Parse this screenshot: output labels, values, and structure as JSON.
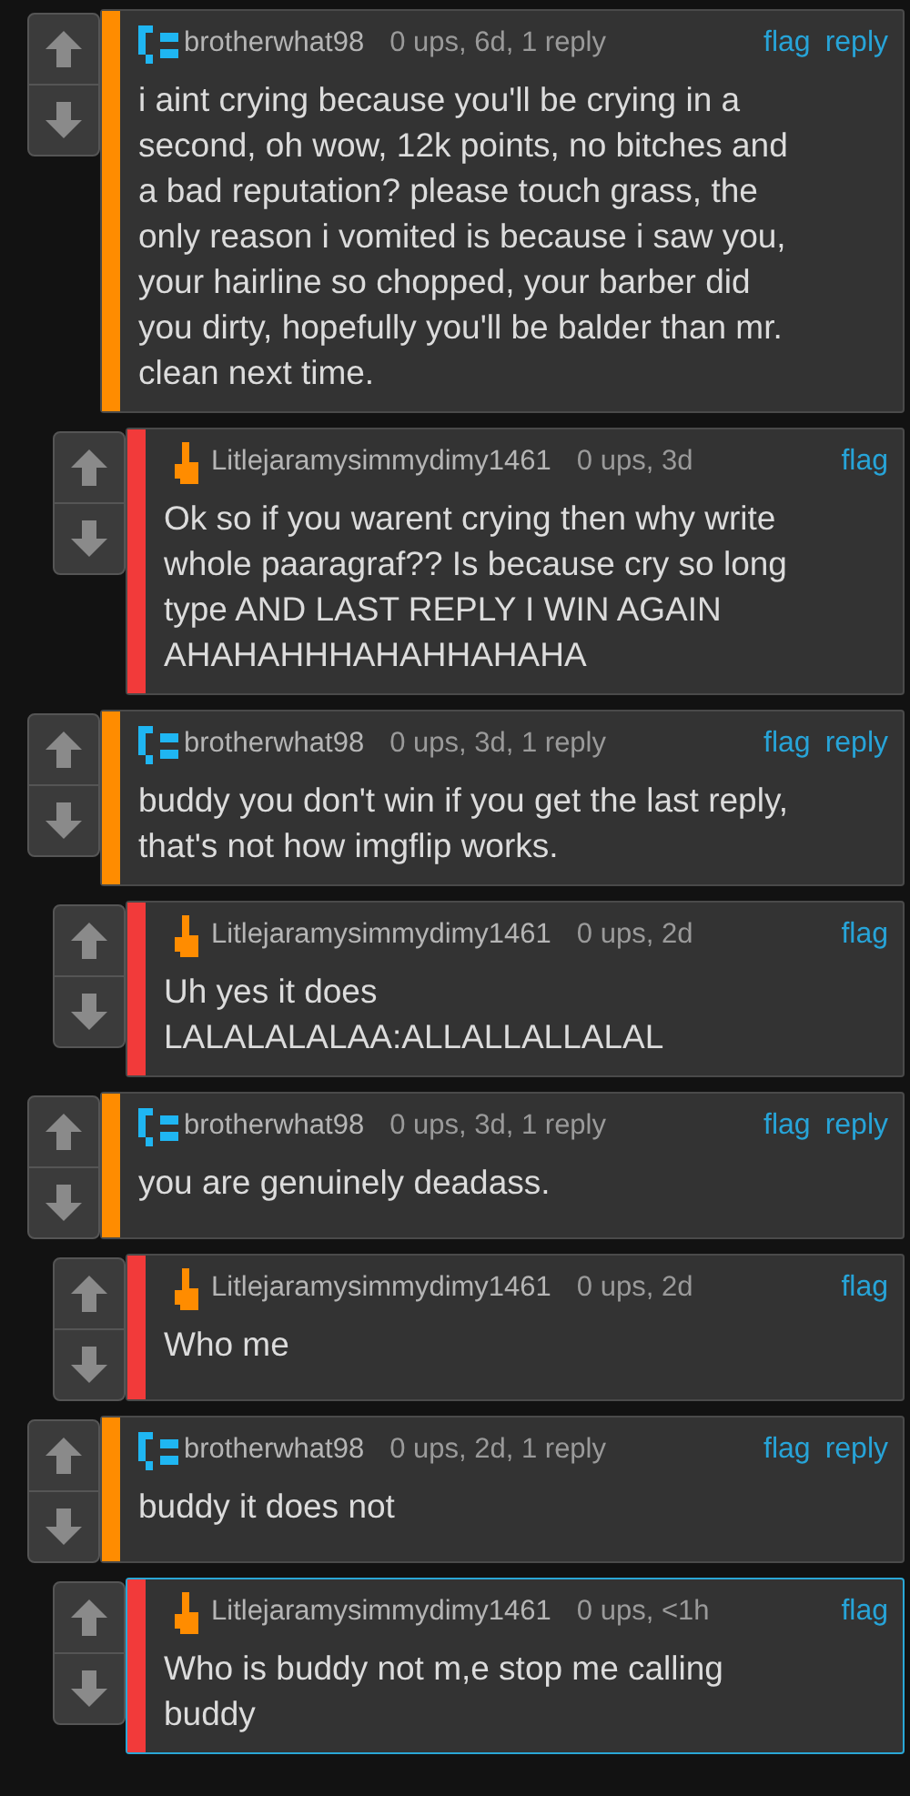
{
  "comments": [
    {
      "kind": "blocks",
      "nested": false,
      "color": "#ff8c00",
      "highlighted": false,
      "user": "brotherwhat98",
      "meta": "0 ups, 6d, 1 reply",
      "actions": [
        "flag",
        "reply"
      ],
      "text": "i aint crying because you'll be crying in a\nsecond, oh wow, 12k points, no bitches and\na bad reputation? please touch grass, the\nonly reason i vomited is because i saw you,\nyour hairline so chopped, your barber did\nyou dirty, hopefully you'll be balder than mr.\nclean next time."
    },
    {
      "kind": "hand",
      "nested": true,
      "color": "#f23a3a",
      "highlighted": false,
      "user": "Litlejaramysimmydimy1461",
      "meta": "0 ups, 3d",
      "actions": [
        "flag"
      ],
      "text": "Ok so if you warent crying then why write\nwhole paaragraf?? Is because cry so long\ntype AND LAST REPLY I WIN AGAIN\nAHAHAHHHAHAHHAHAHA"
    },
    {
      "kind": "blocks",
      "nested": false,
      "color": "#ff8c00",
      "highlighted": false,
      "user": "brotherwhat98",
      "meta": "0 ups, 3d, 1 reply",
      "actions": [
        "flag",
        "reply"
      ],
      "text": "buddy you don't win if you get the last reply,\nthat's not how imgflip works."
    },
    {
      "kind": "hand",
      "nested": true,
      "color": "#f23a3a",
      "highlighted": false,
      "user": "Litlejaramysimmydimy1461",
      "meta": "0 ups, 2d",
      "actions": [
        "flag"
      ],
      "text": "Uh yes it does\nLALALALALAA:ALLALLALLALAL"
    },
    {
      "kind": "blocks",
      "nested": false,
      "color": "#ff8c00",
      "highlighted": false,
      "user": "brotherwhat98",
      "meta": "0 ups, 3d, 1 reply",
      "actions": [
        "flag",
        "reply"
      ],
      "text": "you are genuinely deadass."
    },
    {
      "kind": "hand",
      "nested": true,
      "color": "#f23a3a",
      "highlighted": false,
      "user": "Litlejaramysimmydimy1461",
      "meta": "0 ups, 2d",
      "actions": [
        "flag"
      ],
      "text": "Who me"
    },
    {
      "kind": "blocks",
      "nested": false,
      "color": "#ff8c00",
      "highlighted": false,
      "user": "brotherwhat98",
      "meta": "0 ups, 2d, 1 reply",
      "actions": [
        "flag",
        "reply"
      ],
      "text": "buddy it does not"
    },
    {
      "kind": "hand",
      "nested": true,
      "color": "#f23a3a",
      "highlighted": true,
      "user": "Litlejaramysimmydimy1461",
      "meta": "0 ups, <1h",
      "actions": [
        "flag"
      ],
      "text": "Who is buddy not m,e stop me calling\nbuddy"
    }
  ]
}
